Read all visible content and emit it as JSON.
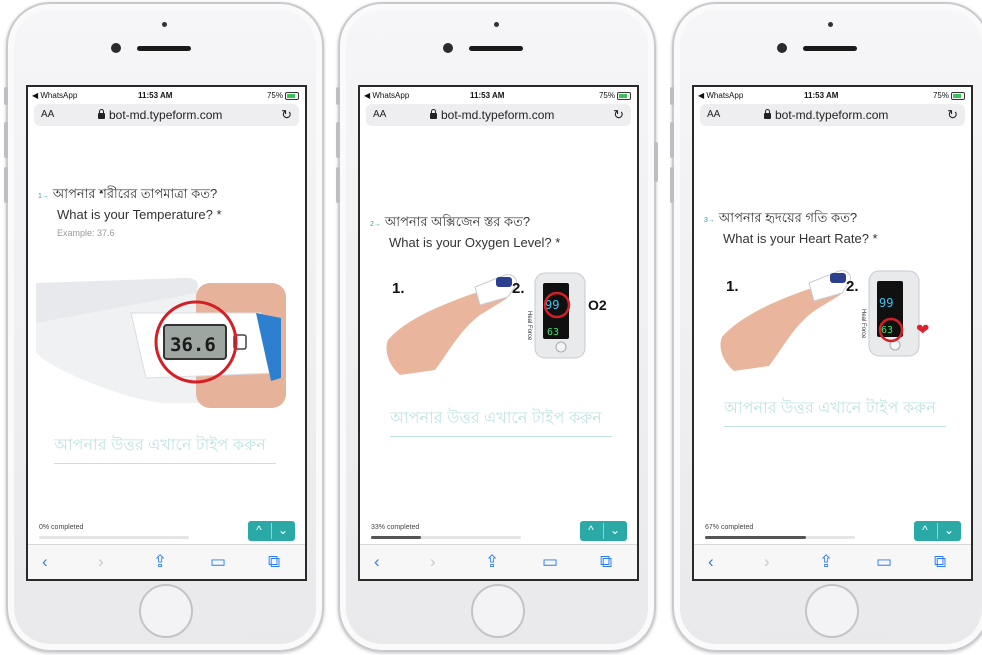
{
  "status": {
    "app": "◀ WhatsApp",
    "time": "11:53 AM",
    "battery": "75%"
  },
  "browser": {
    "aa": "AA",
    "url": "bot-md.typeform.com"
  },
  "phones": [
    {
      "question_number": "1→",
      "question_bn": "আপনার শরীরের তাপমাত্রা কত?",
      "question_en": "What is your Temperature? *",
      "hint": "Example: 37.6",
      "thermometer_reading": "36.6",
      "answer_placeholder": "আপনার উত্তর এখানে টাইপ করুন",
      "progress_text": "0% completed",
      "progress_value": 0
    },
    {
      "question_number": "2→",
      "question_bn": "আপনার অক্সিজেন স্তর কত?",
      "question_en": "What is your Oxygen Level? *",
      "step1": "1.",
      "step2": "2.",
      "reading_top": "99",
      "reading_bottom": "63",
      "label": "O2",
      "device_text": "Heal Force",
      "answer_placeholder": "আপনার উত্তর এখানে টাইপ করুন",
      "progress_text": "33% completed",
      "progress_value": 33
    },
    {
      "question_number": "3→",
      "question_bn": "আপনার হৃদয়ের গতি কত?",
      "question_en": "What is your Heart Rate? *",
      "step1": "1.",
      "step2": "2.",
      "reading_top": "99",
      "reading_bottom": "63",
      "label": "❤",
      "device_text": "Heal Force",
      "answer_placeholder": "আপনার উত্তর এখানে টাইপ করুন",
      "progress_text": "67% completed",
      "progress_value": 67
    }
  ],
  "nav": {
    "up": "^",
    "down": "⌄"
  },
  "toolbar": {
    "back": "‹",
    "forward": "›",
    "share": "⇪",
    "bookmarks": "▭",
    "tabs": "⧉"
  },
  "colors": {
    "accent": "#2aa9a7",
    "link": "#2e7df6",
    "placeholder": "#bfe4e2"
  }
}
